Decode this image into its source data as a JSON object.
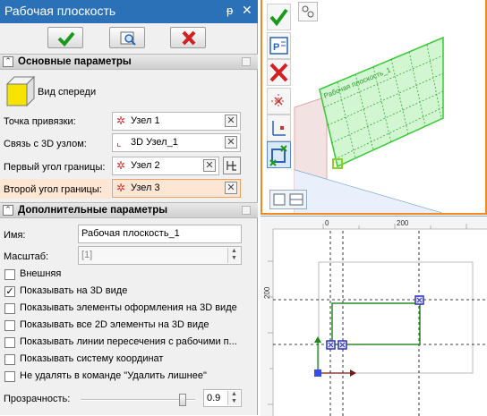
{
  "panel": {
    "title": "Рабочая плоскость",
    "pin_icon": "pin-icon",
    "close_icon": "close-icon",
    "toolbar": {
      "ok": "check-icon",
      "preview": "preview-icon",
      "cancel": "cancel-icon"
    },
    "sections": {
      "main": "Основные параметры",
      "extra": "Дополнительные параметры"
    },
    "view_label": "Вид спереди",
    "fields": [
      {
        "label": "Точка привязки:",
        "value": "Узел 1"
      },
      {
        "label": "Связь с 3D узлом:",
        "value": "3D Узел_1"
      },
      {
        "label": "Первый угол границы:",
        "value": "Узел 2"
      },
      {
        "label": "Второй угол границы:",
        "value": "Узел 3"
      }
    ],
    "name_label": "Имя:",
    "name_value": "Рабочая плоскость_1",
    "scale_label": "Масштаб:",
    "scale_value": "[1]",
    "checkboxes": [
      {
        "label": "Внешняя",
        "checked": false
      },
      {
        "label": "Показывать на 3D виде",
        "checked": true
      },
      {
        "label": "Показывать элементы оформления на 3D виде",
        "checked": false
      },
      {
        "label": "Показывать все 2D элементы на 3D виде",
        "checked": false
      },
      {
        "label": "Показывать линии пересечения с рабочими п...",
        "checked": false
      },
      {
        "label": "Показывать систему координат",
        "checked": false
      },
      {
        "label": "Не удалять в команде \"Удалить лишнее\"",
        "checked": false
      }
    ],
    "transparency_label": "Прозрачность:",
    "transparency_value": "0.9",
    "transparency_level": 0.9
  },
  "view3d": {
    "plane_label": "Рабочая плоскость_1"
  },
  "view2d": {
    "ruler_top": [
      "0",
      "200"
    ],
    "ruler_left": [
      "200"
    ]
  },
  "colors": {
    "title_bar": "#2b71b8",
    "plane_green": "#38c838",
    "active_border": "#f08a24",
    "highlight_field": "#fde7d4"
  }
}
